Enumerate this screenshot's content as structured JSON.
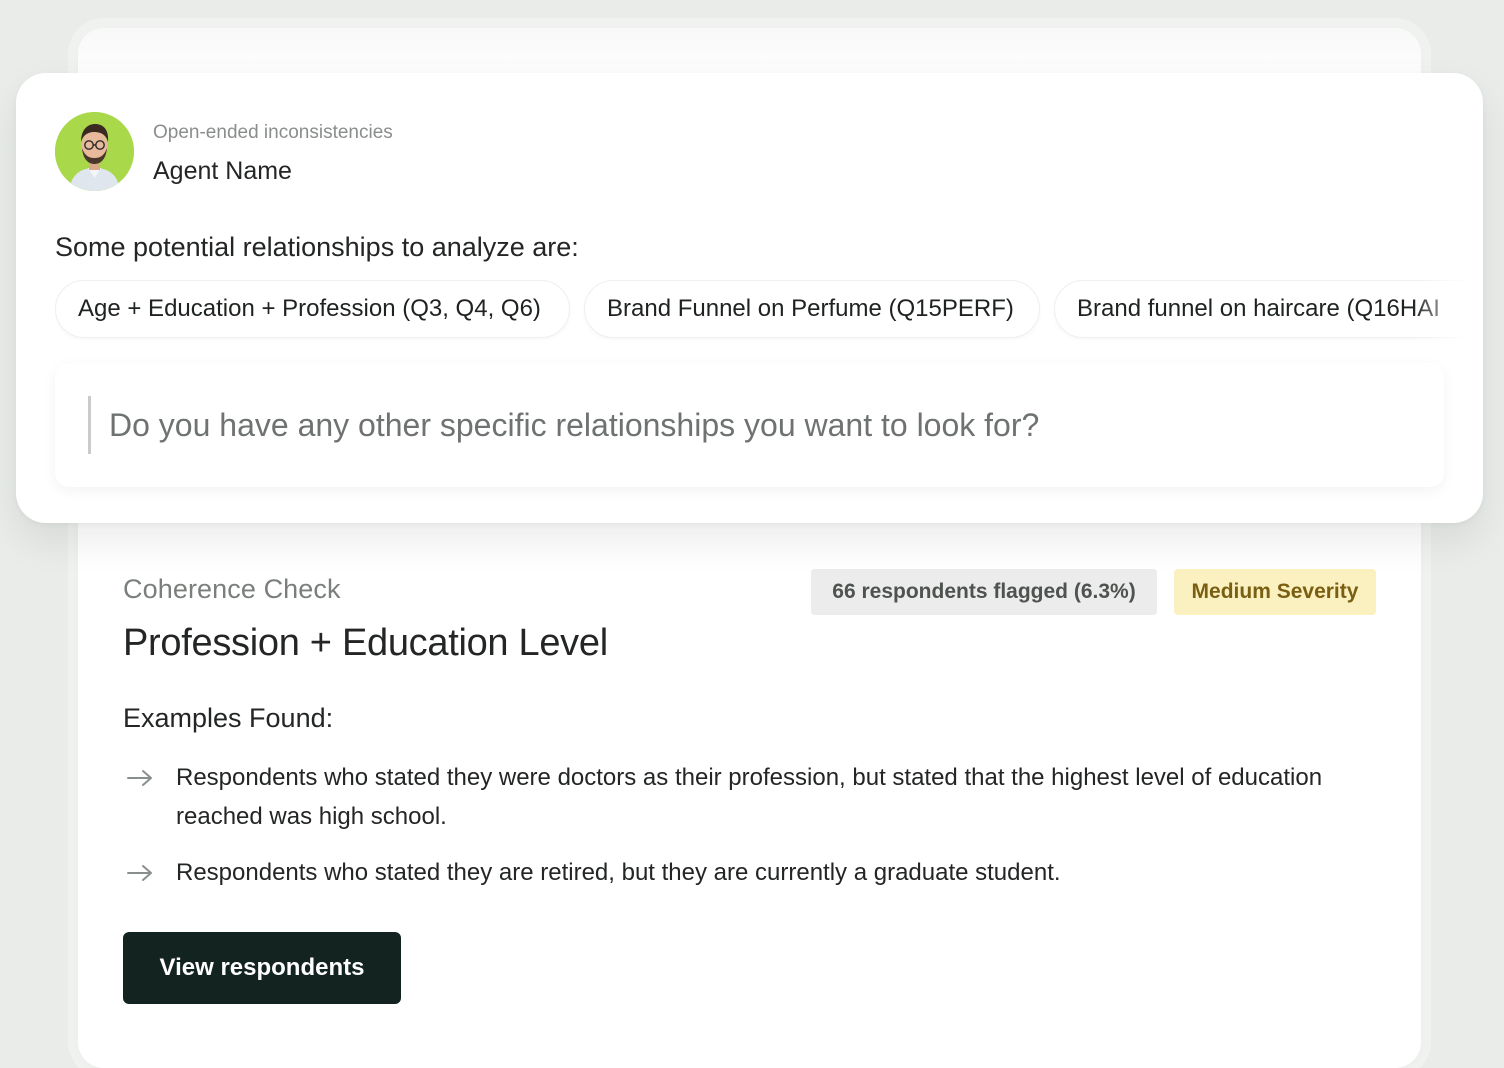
{
  "agent": {
    "subtitle": "Open-ended inconsistencies",
    "name": "Agent Name"
  },
  "relationships": {
    "heading": "Some potential relationships to analyze are:",
    "chips": [
      {
        "label": "Age + Education + Profession (Q3, Q4, Q6)"
      },
      {
        "label": "Brand Funnel on Perfume (Q15PERF)"
      },
      {
        "label": "Brand funnel on haircare (Q16HAI"
      }
    ]
  },
  "prompt": {
    "placeholder": "Do you have any other specific relationships you want to look for?"
  },
  "coherence": {
    "eyebrow": "Coherence Check",
    "title": "Profession + Education Level",
    "flag_badge": "66 respondents flagged (6.3%)",
    "severity_badge": "Medium Severity",
    "examples_heading": "Examples Found:",
    "examples": [
      {
        "text": "Respondents who stated they were doctors as their profession, but stated that the highest level of education reached was high school."
      },
      {
        "text": "Respondents who stated they are retired, but they are currently a graduate student."
      }
    ],
    "button_label": "View respondents"
  },
  "colors": {
    "background": "#e9ece9",
    "avatar_bg": "#a9d94a",
    "button_bg": "#132420",
    "severity_bg": "#fbf0bf",
    "severity_text": "#7a5f12",
    "flag_bg": "#ececec"
  },
  "icons": {
    "example_bullet": "arrow-right-icon"
  }
}
